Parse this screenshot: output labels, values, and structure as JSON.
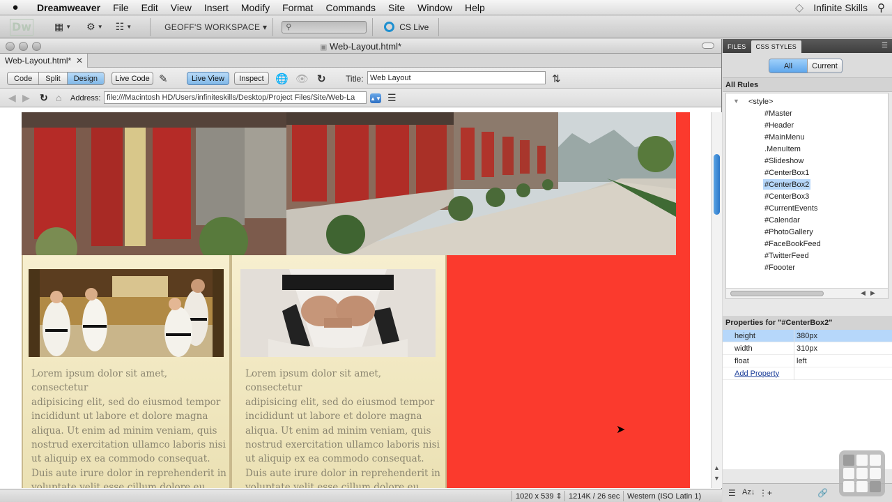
{
  "menubar": {
    "apple": "",
    "items": [
      "Dreamweaver",
      "File",
      "Edit",
      "View",
      "Insert",
      "Modify",
      "Format",
      "Commands",
      "Site",
      "Window",
      "Help"
    ],
    "right_text": "Infinite Skills"
  },
  "apptoolbar": {
    "logo": "Dw",
    "workspace": "GEOFF'S WORKSPACE ▾",
    "search_placeholder": "",
    "cs_live": "CS Live"
  },
  "document": {
    "window_title": "Web-Layout.html*",
    "tab_label": "Web-Layout.html*",
    "view_buttons": [
      "Code",
      "Split",
      "Design"
    ],
    "active_view": "Design",
    "live_code": "Live Code",
    "live_view": "Live View",
    "inspect": "Inspect",
    "title_label": "Title:",
    "title_value": "Web Layout",
    "address_label": "Address:",
    "address_value": "file:///Macintosh HD/Users/infiniteskills/Desktop/Project Files/Site/Web-La"
  },
  "page": {
    "lorem": "Lorem ipsum dolor sit amet, consectetur adipisicing elit, sed do eiusmod tempor incididunt ut labore et dolore magna aliqua. Ut enim ad minim veniam, quis nostrud exercitation ullamco laboris nisi ut aliquip ex ea commodo consequat. Duis aute irure dolor in reprehenderit in voluptate velit esse cillum dolore eu fugiat",
    "lorem_lines": [
      "Lorem ipsum dolor sit amet, consectetur",
      "adipisicing elit, sed do eiusmod tempor",
      "incididunt ut labore et dolore magna",
      "aliqua. Ut enim ad minim veniam, quis",
      "nostrud exercitation ullamco laboris nisi",
      "ut aliquip ex ea commodo consequat.",
      "Duis aute irure dolor in reprehenderit in",
      "voluptate velit esse cillum dolore eu fugiat"
    ]
  },
  "statusbar": {
    "window_size": "1020 x 539 ⇕",
    "file_size": "1214K / 26 sec",
    "encoding": "Western (ISO Latin 1)"
  },
  "panel": {
    "tabs": [
      "FILES",
      "CSS STYLES"
    ],
    "active_tab": "CSS STYLES",
    "mode_buttons": [
      "All",
      "Current"
    ],
    "active_mode": "All",
    "all_rules_header": "All Rules",
    "root_rule": "<style>",
    "rules": [
      "#Master",
      "#Header",
      "#MainMenu",
      ".MenuItem",
      "#Slideshow",
      "#CenterBox1",
      "#CenterBox2",
      "#CenterBox3",
      "#CurrentEvents",
      "#Calendar",
      "#PhotoGallery",
      "#FaceBookFeed",
      "#TwitterFeed",
      "#Foooter"
    ],
    "selected_rule": "#CenterBox2",
    "properties_header": "Properties for \"#CenterBox2\"",
    "properties": [
      {
        "name": "height",
        "value": "380px"
      },
      {
        "name": "width",
        "value": "310px"
      },
      {
        "name": "float",
        "value": "left"
      }
    ],
    "add_property": "Add Property"
  },
  "colors": {
    "red_box": "#fb3a2d",
    "box_bg": "#f3ebc8",
    "selection": "#b6d7fa",
    "lorem_text": "#8a8570"
  }
}
